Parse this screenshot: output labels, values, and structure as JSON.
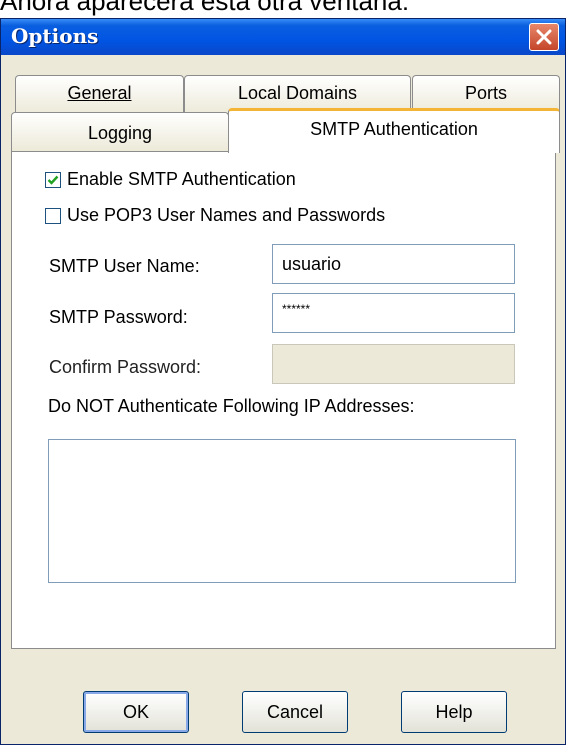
{
  "caption": "Ahora aparecera esta otra ventana:",
  "window": {
    "title": "Options"
  },
  "tabs": [
    {
      "label": "General",
      "accel_index": 0
    },
    {
      "label": "Local Domains",
      "accel_index": 0
    },
    {
      "label": "Ports",
      "accel_index": 0
    },
    {
      "label": "Logging",
      "accel_index": 1
    },
    {
      "label": "SMTP Authentication",
      "accel_index": 0,
      "active": true
    }
  ],
  "form": {
    "enable_auth": {
      "label": "Enable SMTP Authentication",
      "checked": true
    },
    "use_pop3": {
      "label": "Use POP3 User Names and Passwords",
      "checked": false
    },
    "user_name": {
      "label": "SMTP User Name:",
      "value": "usuario"
    },
    "password": {
      "label": "SMTP Password:",
      "value": "******"
    },
    "confirm": {
      "label": "Confirm Password:",
      "value": ""
    },
    "ip_list": {
      "label": "Do NOT Authenticate Following IP Addresses:"
    }
  },
  "buttons": {
    "ok": "OK",
    "cancel": "Cancel",
    "help": "Help"
  },
  "colors": {
    "titlebar": "#0054e3",
    "active_tab_accent": "#f4b537",
    "check": "#21a121"
  }
}
